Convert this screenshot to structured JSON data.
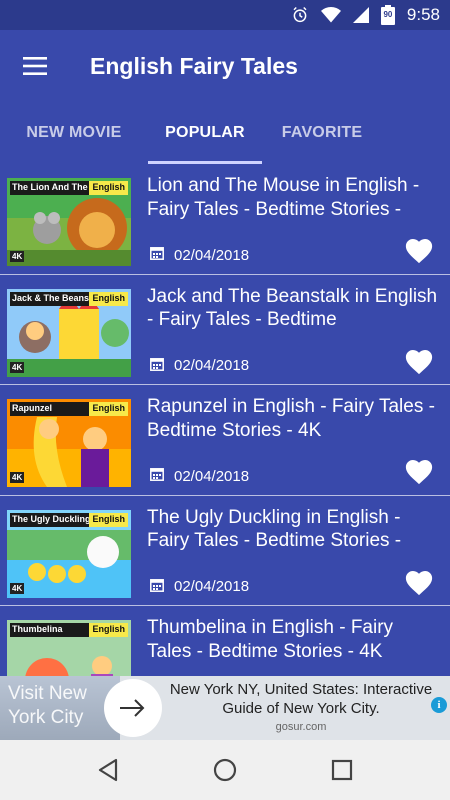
{
  "status_bar": {
    "time": "9:58",
    "battery_level": "90",
    "icons": [
      "alarm-icon",
      "wifi-icon",
      "signal-icon",
      "battery-icon"
    ]
  },
  "app_bar": {
    "title": "English Fairy Tales",
    "menu_icon": "hamburger-menu-icon"
  },
  "tabs": [
    {
      "label": "NEW MOVIE",
      "active": false
    },
    {
      "label": "POPULAR",
      "active": true
    },
    {
      "label": "FAVORITE",
      "active": false
    }
  ],
  "videos": [
    {
      "thumb_title": "The Lion And The Mouse",
      "thumb_lang": "English",
      "thumb_badge": "4K",
      "title": "Lion and The Mouse in English - Fairy Tales - Bedtime Stories -",
      "date": "02/04/2018"
    },
    {
      "thumb_title": "Jack & The Beanstalk",
      "thumb_lang": "English",
      "thumb_badge": "4K",
      "title": "Jack and The Beanstalk in English - Fairy Tales - Bedtime",
      "date": "02/04/2018"
    },
    {
      "thumb_title": "Rapunzel",
      "thumb_lang": "English",
      "thumb_badge": "4K",
      "title": "Rapunzel in English - Fairy Tales - Bedtime Stories - 4K",
      "date": "02/04/2018"
    },
    {
      "thumb_title": "The Ugly Duckling",
      "thumb_lang": "English",
      "thumb_badge": "4K",
      "title": "The Ugly Duckling in English - Fairy Tales - Bedtime Stories -",
      "date": "02/04/2018"
    },
    {
      "thumb_title": "Thumbelina",
      "thumb_lang": "English",
      "thumb_badge": "4K",
      "title": "Thumbelina in English - Fairy Tales - Bedtime Stories - 4K",
      "date": ""
    }
  ],
  "ad": {
    "left_text": "Visit New York City",
    "headline": "New York NY, United States: Interactive Guide of New York City.",
    "domain": "gosur.com",
    "info_icon": "i"
  },
  "nav_bar": {
    "icons": [
      "back-icon",
      "home-icon",
      "recents-icon"
    ]
  },
  "colors": {
    "primary": "#3949ab",
    "status_bar": "#2c3a8c",
    "accent_underline": "#cfd3ff"
  }
}
